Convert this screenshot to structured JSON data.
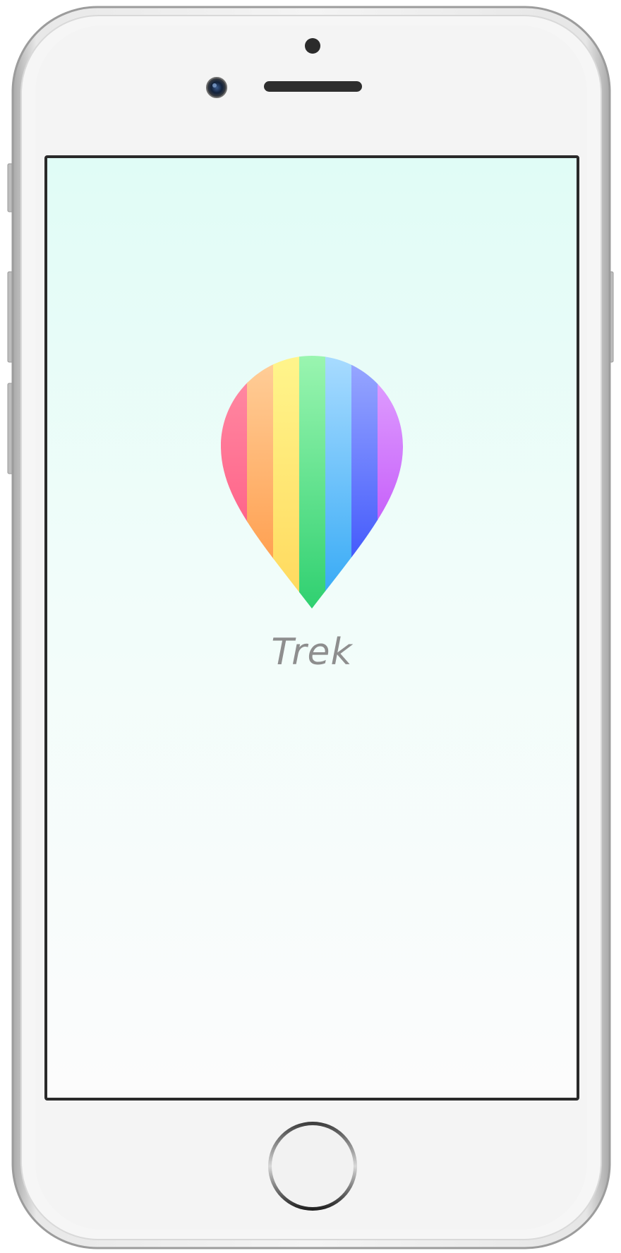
{
  "app": {
    "name": "Trek"
  },
  "colors": {
    "screen_top": "#e0fcf6",
    "screen_bottom": "#fcfcfc",
    "title_text": "#8e8e8e",
    "pin_stripes": [
      "#ff5f86",
      "#ffa751",
      "#ffe56f",
      "#3dd67a",
      "#43b3f4",
      "#4a5cf9",
      "#c653f5"
    ]
  },
  "icons": {
    "app_logo": "rainbow-map-pin-icon",
    "camera": "front-camera-icon",
    "speaker": "earpiece-speaker-icon",
    "home": "home-button-icon"
  }
}
